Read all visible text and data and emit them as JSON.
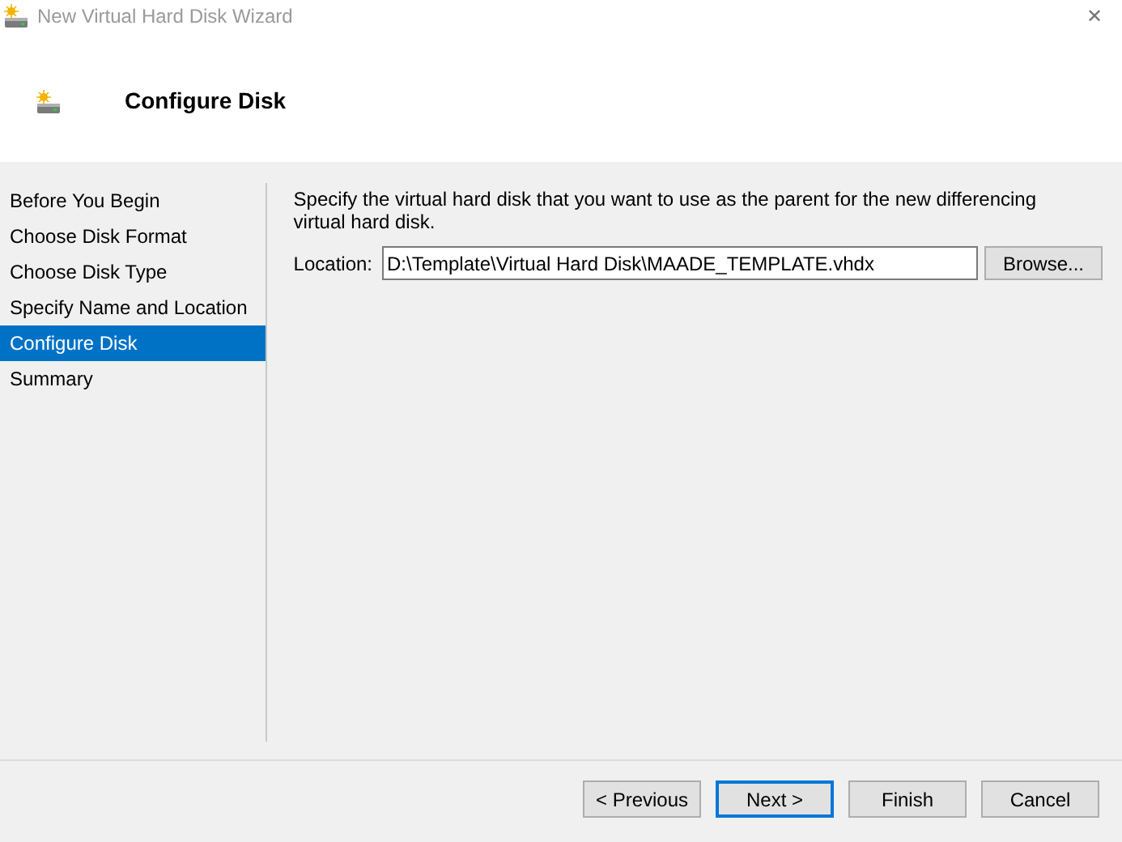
{
  "window": {
    "title": "New Virtual Hard Disk Wizard",
    "close": "✕"
  },
  "header": {
    "title": "Configure Disk"
  },
  "steps": [
    {
      "label": "Before You Begin",
      "selected": false
    },
    {
      "label": "Choose Disk Format",
      "selected": false
    },
    {
      "label": "Choose Disk Type",
      "selected": false
    },
    {
      "label": "Specify Name and Location",
      "selected": false
    },
    {
      "label": "Configure Disk",
      "selected": true
    },
    {
      "label": "Summary",
      "selected": false
    }
  ],
  "content": {
    "description": "Specify the virtual hard disk that you want to use as the parent for the new differencing virtual hard disk.",
    "location_label": "Location:",
    "location_value": "D:\\Template\\Virtual Hard Disk\\MAADE_TEMPLATE.vhdx",
    "browse": "Browse..."
  },
  "buttons": [
    {
      "label": "< Previous",
      "default": false
    },
    {
      "label": "Next >",
      "default": true
    },
    {
      "label": "Finish",
      "default": false
    },
    {
      "label": "Cancel",
      "default": false
    }
  ]
}
